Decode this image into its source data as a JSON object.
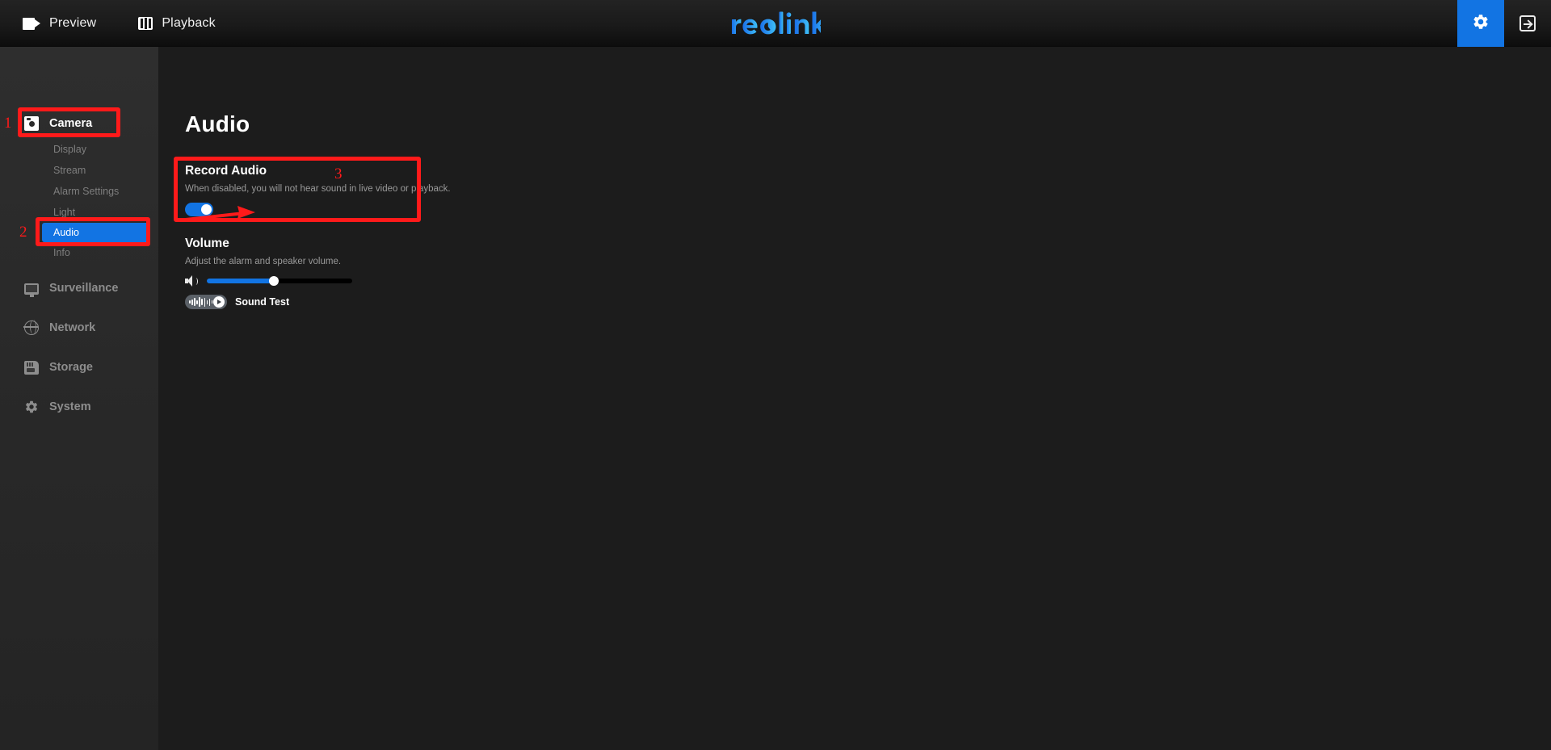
{
  "topbar": {
    "nav": [
      {
        "label": "Preview",
        "icon": "video-camera-icon"
      },
      {
        "label": "Playback",
        "icon": "film-strip-icon"
      }
    ],
    "logo_text": "reolink",
    "logo_colors": {
      "start": "#1a6fe8",
      "end": "#3fc0f7"
    },
    "settings_icon": "gear-icon",
    "logout_icon": "logout-arrow-icon",
    "accent": "#1274e3"
  },
  "sidebar": {
    "groups": [
      {
        "label": "Camera",
        "icon": "camera-icon",
        "active": true,
        "items": [
          {
            "label": "Display",
            "selected": false
          },
          {
            "label": "Stream",
            "selected": false
          },
          {
            "label": "Alarm Settings",
            "selected": false
          },
          {
            "label": "Light",
            "selected": false
          },
          {
            "label": "Audio",
            "selected": true
          },
          {
            "label": "Info",
            "selected": false
          }
        ]
      },
      {
        "label": "Surveillance",
        "icon": "monitor-icon",
        "active": false,
        "items": []
      },
      {
        "label": "Network",
        "icon": "globe-icon",
        "active": false,
        "items": []
      },
      {
        "label": "Storage",
        "icon": "sd-card-icon",
        "active": false,
        "items": []
      },
      {
        "label": "System",
        "icon": "gear-icon",
        "active": false,
        "items": []
      }
    ]
  },
  "main": {
    "page_title": "Audio",
    "record_audio": {
      "heading": "Record Audio",
      "description": "When disabled, you will not hear sound in live video or playback.",
      "toggle_state": "on"
    },
    "volume": {
      "heading": "Volume",
      "description": "Adjust the alarm and speaker volume.",
      "speaker_icon": "speaker-icon",
      "slider_percent": 46,
      "sound_test": {
        "label": "Sound Test",
        "waveform_icon": "waveform-icon",
        "play_icon": "play-icon"
      }
    }
  },
  "annotations": {
    "color": "#ff1a1a",
    "markers": [
      {
        "number": "1",
        "target": "sidebar-group-camera"
      },
      {
        "number": "2",
        "target": "sidebar-item-audio"
      },
      {
        "number": "3",
        "target": "record-audio-section"
      }
    ],
    "arrow": {
      "points_to": "record-audio-toggle"
    }
  }
}
